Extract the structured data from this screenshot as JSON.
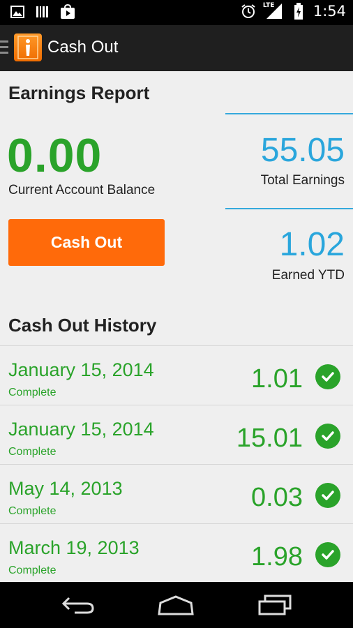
{
  "status_bar": {
    "time": "1:54",
    "network": "LTE",
    "icons": [
      "picture-icon",
      "barcode-icon",
      "play-store-icon",
      "alarm-icon",
      "signal-icon",
      "battery-icon"
    ]
  },
  "action_bar": {
    "title": "Cash Out",
    "logo": "info-logo-icon"
  },
  "earnings": {
    "title": "Earnings Report",
    "balance_value": "0.00",
    "balance_label": "Current Account Balance",
    "cash_out_label": "Cash Out",
    "total_earnings_value": "55.05",
    "total_earnings_label": "Total Earnings",
    "earned_ytd_value": "1.02",
    "earned_ytd_label": "Earned YTD"
  },
  "history": {
    "title": "Cash Out History",
    "rows": [
      {
        "date": "January 15, 2014",
        "status": "Complete",
        "amount": "1.01"
      },
      {
        "date": "January 15, 2014",
        "status": "Complete",
        "amount": "15.01"
      },
      {
        "date": "May 14, 2013",
        "status": "Complete",
        "amount": "0.03"
      },
      {
        "date": "March 19, 2013",
        "status": "Complete",
        "amount": "1.98"
      }
    ]
  },
  "colors": {
    "green": "#2aa32a",
    "blue": "#2aa6dc",
    "orange": "#ff6a0a"
  },
  "nav_bar": {
    "buttons": [
      "back-icon",
      "home-icon",
      "recent-apps-icon"
    ]
  }
}
